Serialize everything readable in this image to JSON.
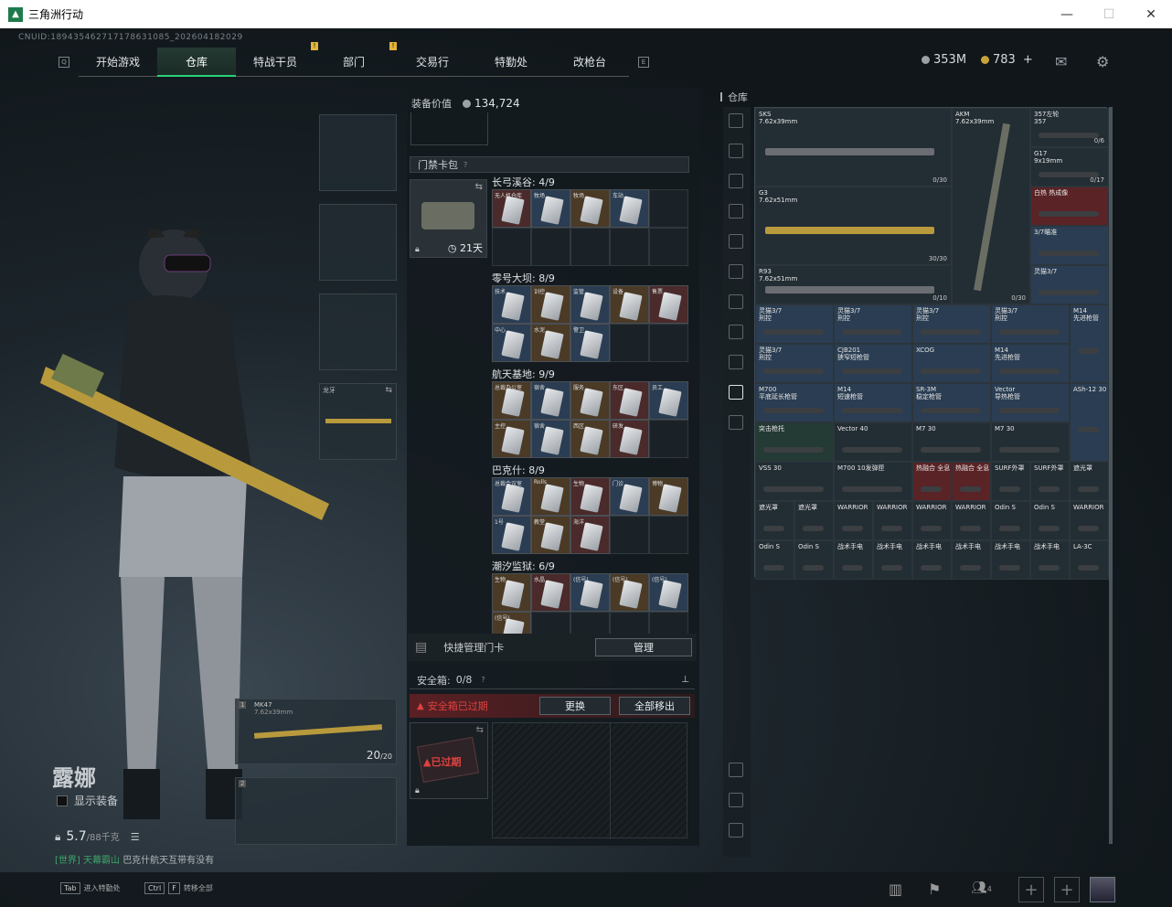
{
  "window": {
    "title": "三角洲行动",
    "minimize": "—",
    "maximize": "☐",
    "close": "✕"
  },
  "uid": "CNUID:189435462717178631085_202604182029",
  "nav": {
    "tabs": [
      "开始游戏",
      "仓库",
      "特战干员",
      "部门",
      "交易行",
      "特勤处",
      "改枪台"
    ],
    "active_index": 1,
    "badge": "!"
  },
  "currency": {
    "silver": "353M",
    "gold": "783",
    "gold_plus": "+"
  },
  "character": {
    "name": "露娜",
    "show_equip": "显示装备",
    "weight_value": "5.7",
    "weight_max": "/88千克",
    "chat_channel": "[世界]",
    "chat_user": "天幕霸山",
    "chat_msg": "巴克什航天互带有没有"
  },
  "equip_slots": {
    "melee": {
      "label": "龙牙"
    },
    "primary1": {
      "index": "1",
      "name": "MK47",
      "caliber": "7.62x39mm",
      "ammo": "20",
      "ammo_max": "/20"
    },
    "primary2": {
      "index": "2"
    }
  },
  "middle": {
    "equip_value_label": "装备价值",
    "equip_value": "134,724",
    "keycard_bag_label": "门禁卡包",
    "keycard_help": "?",
    "keycard_days": "21天",
    "sections": [
      {
        "title": "长弓溪谷: 4/9",
        "cards": [
          "无人机仓库",
          "牧场",
          "牧场",
          "车站"
        ]
      },
      {
        "title": "零号大坝: 8/9",
        "cards": [
          "技术",
          "训控",
          "监管",
          "设备",
          "售票",
          "中心",
          "水泥",
          "警卫"
        ]
      },
      {
        "title": "航天基地: 9/9",
        "cards": [
          "总裁办公室",
          "宿舍",
          "服务",
          "东区",
          "员工",
          "主控",
          "宿舍",
          "西区",
          "研发"
        ]
      },
      {
        "title": "巴克什: 8/9",
        "cards": [
          "总裁会议室",
          "Rolls",
          "生物",
          "门诊",
          "博物",
          "1号",
          "教堂",
          "海洋"
        ]
      },
      {
        "title": "潮汐监狱: 6/9",
        "cards": [
          "生物",
          "水晶",
          "(信号)",
          "(信号)",
          "(信号)",
          "(信号)"
        ]
      }
    ],
    "quick_manage_label": "快捷管理门卡",
    "manage_btn": "管理",
    "safebox_label": "安全箱:",
    "safebox_value": "0/8",
    "safebox_help": "?",
    "safebox_expired": "安全箱已过期",
    "replace_btn": "更换",
    "move_all_btn": "全部移出",
    "expired_stamp": "已过期"
  },
  "stash": {
    "title": "仓库",
    "items": [
      {
        "name": "SKS",
        "cal": "7.62x39mm",
        "count": "0/30"
      },
      {
        "name": "AKM",
        "cal": "7.62x39mm",
        "count": "0/30"
      },
      {
        "name": "357左轮",
        "cal": "357",
        "count": "0/6"
      },
      {
        "name": "G17",
        "cal": "9x19mm",
        "count": "0/17"
      },
      {
        "name": "G3",
        "cal": "7.62x51mm",
        "count": "30/30"
      },
      {
        "name": "白热 热成像",
        "cal": "",
        "count": ""
      },
      {
        "name": "3/7瞄准",
        "cal": "",
        "count": ""
      },
      {
        "name": "R93",
        "cal": "7.62x51mm",
        "count": "0/10"
      },
      {
        "name": "灵猫3/7",
        "cal": "",
        "count": ""
      },
      {
        "name": "灵猫3/7",
        "cal": "刑控",
        "count": ""
      },
      {
        "name": "灵猫3/7",
        "cal": "刑控",
        "count": ""
      },
      {
        "name": "灵猫3/7",
        "cal": "刑控",
        "count": ""
      },
      {
        "name": "灵猫3/7",
        "cal": "刑控",
        "count": ""
      },
      {
        "name": "M14",
        "cal": "先进枪管",
        "count": ""
      },
      {
        "name": "灵猫3/7",
        "cal": "刑控",
        "count": ""
      },
      {
        "name": "CJB201",
        "cal": "狭窄短枪管",
        "count": ""
      },
      {
        "name": "XCOG",
        "cal": "",
        "count": ""
      },
      {
        "name": "M14",
        "cal": "先进枪管",
        "count": ""
      },
      {
        "name": "M700",
        "cal": "平底延长枪管",
        "count": ""
      },
      {
        "name": "M14",
        "cal": "短速枪管",
        "count": ""
      },
      {
        "name": "SR-3M",
        "cal": "稳定枪管",
        "count": ""
      },
      {
        "name": "Vector",
        "cal": "导热枪管",
        "count": ""
      },
      {
        "name": "ASh-12 30",
        "cal": "",
        "count": ""
      },
      {
        "name": "突击枪托",
        "cal": "",
        "count": ""
      },
      {
        "name": "Vector 40",
        "cal": "",
        "count": ""
      },
      {
        "name": "M7 30",
        "cal": "",
        "count": ""
      },
      {
        "name": "M7 30",
        "cal": "",
        "count": ""
      },
      {
        "name": "VSS 30",
        "cal": "",
        "count": ""
      },
      {
        "name": "M700 10发弹匣",
        "cal": "",
        "count": ""
      },
      {
        "name": "热融合 全息",
        "cal": "",
        "count": ""
      },
      {
        "name": "热融合 全息",
        "cal": "",
        "count": ""
      },
      {
        "name": "SURF外罩",
        "cal": "",
        "count": ""
      },
      {
        "name": "SURF外罩",
        "cal": "",
        "count": ""
      },
      {
        "name": "遮光罩",
        "cal": "",
        "count": ""
      },
      {
        "name": "遮光罩",
        "cal": "",
        "count": ""
      },
      {
        "name": "遮光罩",
        "cal": "",
        "count": ""
      },
      {
        "name": "WARRIOR",
        "cal": "",
        "count": ""
      },
      {
        "name": "WARRIOR",
        "cal": "",
        "count": ""
      },
      {
        "name": "WARRIOR",
        "cal": "",
        "count": ""
      },
      {
        "name": "WARRIOR",
        "cal": "",
        "count": ""
      },
      {
        "name": "WARRIOR",
        "cal": "",
        "count": ""
      },
      {
        "name": "Odin S",
        "cal": "",
        "count": ""
      },
      {
        "name": "Odin S",
        "cal": "",
        "count": ""
      },
      {
        "name": "Odin S",
        "cal": "",
        "count": ""
      },
      {
        "name": "Odin S",
        "cal": "",
        "count": ""
      },
      {
        "name": "战术手电",
        "cal": "",
        "count": ""
      },
      {
        "name": "战术手电",
        "cal": "",
        "count": ""
      },
      {
        "name": "战术手电",
        "cal": "",
        "count": ""
      },
      {
        "name": "战术手电",
        "cal": "",
        "count": ""
      },
      {
        "name": "战术手电",
        "cal": "",
        "count": ""
      },
      {
        "name": "战术手电",
        "cal": "",
        "count": ""
      },
      {
        "name": "LA-3C",
        "cal": "",
        "count": ""
      }
    ]
  },
  "bottom": {
    "tab_key": "Tab",
    "tab_text": "进入特勤处",
    "ctrl_key": "Ctrl",
    "f_key": "F",
    "ctrl_text": "转移全部",
    "squad_count": "4",
    "plus": "+"
  }
}
